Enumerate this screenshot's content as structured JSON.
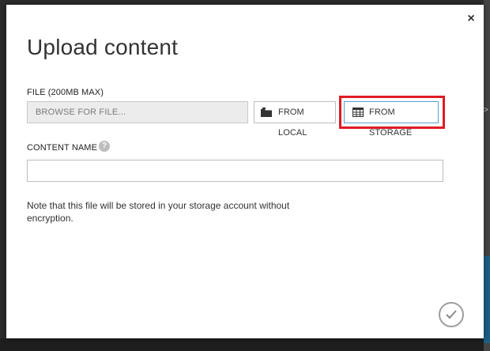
{
  "dialog": {
    "title": "Upload content",
    "close_glyph": "×",
    "file_label": "FILE (200MB MAX)",
    "browse_placeholder": "BROWSE FOR FILE...",
    "from_local_label": "FROM LOCAL",
    "from_storage_label": "FROM STORAGE",
    "content_name_label": "CONTENT NAME",
    "help_glyph": "?",
    "content_name_value": "",
    "note": "Note that this file will be stored in your storage account without encryption."
  },
  "icons": {
    "close": "close-icon",
    "help": "question-mark-icon",
    "from_local": "folder-icon",
    "from_storage": "table-icon",
    "ok": "checkmark-icon"
  },
  "colors": {
    "highlight": "#e01b24",
    "storage_button_border": "#5aa0d6",
    "background_accent": "#1c5f86"
  }
}
